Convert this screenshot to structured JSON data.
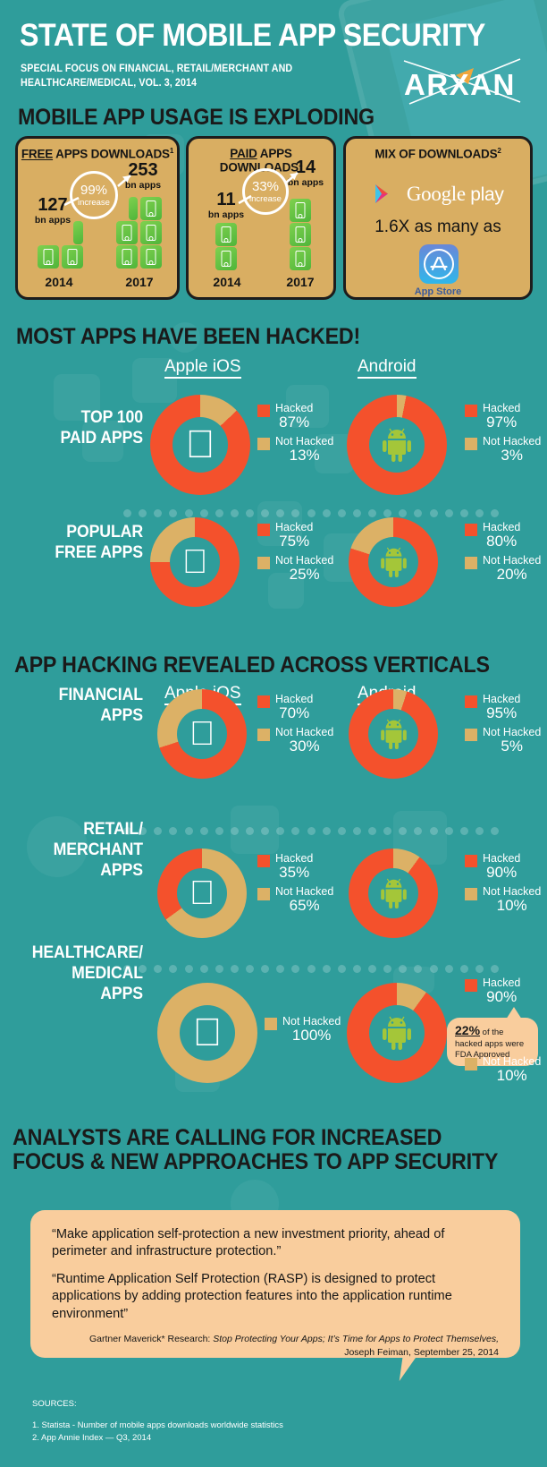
{
  "header": {
    "title": "STATE OF MOBILE APP SECURITY",
    "subtitle": "SPECIAL FOCUS ON FINANCIAL, RETAIL/MERCHANT AND\nHEALTHCARE/MEDICAL, VOL. 3, 2014",
    "logo_text": "ARXAN"
  },
  "section1": {
    "heading": "MOBILE APP USAGE IS EXPLODING",
    "boxes": [
      {
        "title_underline": "FREE",
        "title_rest": " APPS DOWNLOADS",
        "sup": "1",
        "from_value": "127",
        "from_unit": "bn apps",
        "to_value": "253",
        "to_unit": "bn apps",
        "badge_pct": "99%",
        "badge_word": "increase",
        "year_from": "2014",
        "year_to": "2017"
      },
      {
        "title_underline": "PAID",
        "title_rest": " APPS DOWNLOADS",
        "sup": "1",
        "from_value": "11",
        "from_unit": "bn apps",
        "to_value": "14",
        "to_unit": "bn apps",
        "badge_pct": "33%",
        "badge_word": "increase",
        "year_from": "2014",
        "year_to": "2017"
      }
    ],
    "mix_box": {
      "title": "MIX OF DOWNLOADS",
      "sup": "2",
      "store_a_brand": "Google",
      "store_a_brand2": "play",
      "middle_text": "1.6X as many as",
      "store_b_label": "App Store"
    }
  },
  "section2": {
    "heading": "MOST APPS HAVE BEEN HACKED!",
    "platform_labels": [
      "Apple iOS",
      "Android"
    ],
    "rows": [
      {
        "label": "TOP 100\nPAID APPS",
        "ios": {
          "hacked_label": "Hacked",
          "hacked": "87%",
          "not_label": "Not Hacked",
          "not": "13%"
        },
        "android": {
          "hacked_label": "Hacked",
          "hacked": "97%",
          "not_label": "Not Hacked",
          "not": "3%"
        }
      },
      {
        "label": "POPULAR\nFREE APPS",
        "ios": {
          "hacked_label": "Hacked",
          "hacked": "75%",
          "not_label": "Not Hacked",
          "not": "25%"
        },
        "android": {
          "hacked_label": "Hacked",
          "hacked": "80%",
          "not_label": "Not Hacked",
          "not": "20%"
        }
      }
    ]
  },
  "section3": {
    "heading": "APP HACKING REVEALED ACROSS VERTICALS",
    "platform_labels": [
      "Apple iOS",
      "Android"
    ],
    "rows": [
      {
        "label": "FINANCIAL\nAPPS",
        "ios": {
          "hacked_label": "Hacked",
          "hacked": "70%",
          "not_label": "Not Hacked",
          "not": "30%"
        },
        "android": {
          "hacked_label": "Hacked",
          "hacked": "95%",
          "not_label": "Not Hacked",
          "not": "5%"
        }
      },
      {
        "label": "RETAIL/\nMERCHANT\nAPPS",
        "ios": {
          "hacked_label": "Hacked",
          "hacked": "35%",
          "not_label": "Not Hacked",
          "not": "65%"
        },
        "android": {
          "hacked_label": "Hacked",
          "hacked": "90%",
          "not_label": "Not Hacked",
          "not": "10%"
        }
      },
      {
        "label": "HEALTHCARE/\nMEDICAL\nAPPS",
        "ios": {
          "not_label": "Not Hacked",
          "not": "100%"
        },
        "android": {
          "hacked_label": "Hacked",
          "hacked": "90%",
          "not_label": "Not Hacked",
          "not": "10%"
        },
        "callout": {
          "big": "22%",
          "small": " of the",
          "line2": "hacked apps were",
          "line3": "FDA Approved"
        }
      }
    ]
  },
  "section4": {
    "heading": "ANALYSTS ARE CALLING FOR INCREASED\nFOCUS & NEW APPROACHES TO APP SECURITY",
    "quote1": "“Make application self-protection a new investment priority, ahead of perimeter and infrastructure protection.”",
    "quote2": "“Runtime Application Self Protection (RASP) is designed to protect applications by adding protection features into the application runtime environment”",
    "cite_pre": "Gartner Maverick* Research: ",
    "cite_em": "Stop Protecting Your Apps; It’s Time for Apps to Protect Themselves,",
    "cite_post": "Joseph Feiman, September 25, 2014"
  },
  "sources": {
    "heading": "SOURCES:",
    "items": [
      "1. Statista - Number of mobile apps downloads worldwide statistics",
      "2. App Annie Index — Q3, 2014"
    ]
  },
  "colors": {
    "background": "#2f9d9b",
    "hacked": "#f4512c",
    "not_hacked": "#dcb166",
    "gold_box": "#d9ae62",
    "peach": "#f9cd9d",
    "heading_dark": "#1a1a1a",
    "white": "#ffffff"
  },
  "chart_data": [
    {
      "type": "pie",
      "title": "TOP 100 PAID APPS — Apple iOS",
      "labels": [
        "Hacked",
        "Not Hacked"
      ],
      "values": [
        87,
        13
      ],
      "unit": "%"
    },
    {
      "type": "pie",
      "title": "TOP 100 PAID APPS — Android",
      "labels": [
        "Hacked",
        "Not Hacked"
      ],
      "values": [
        97,
        3
      ],
      "unit": "%"
    },
    {
      "type": "pie",
      "title": "POPULAR FREE APPS — Apple iOS",
      "labels": [
        "Hacked",
        "Not Hacked"
      ],
      "values": [
        75,
        25
      ],
      "unit": "%"
    },
    {
      "type": "pie",
      "title": "POPULAR FREE APPS — Android",
      "labels": [
        "Hacked",
        "Not Hacked"
      ],
      "values": [
        80,
        20
      ],
      "unit": "%"
    },
    {
      "type": "pie",
      "title": "FINANCIAL APPS — Apple iOS",
      "labels": [
        "Hacked",
        "Not Hacked"
      ],
      "values": [
        70,
        30
      ],
      "unit": "%"
    },
    {
      "type": "pie",
      "title": "FINANCIAL APPS — Android",
      "labels": [
        "Hacked",
        "Not Hacked"
      ],
      "values": [
        95,
        5
      ],
      "unit": "%"
    },
    {
      "type": "pie",
      "title": "RETAIL/MERCHANT APPS — Apple iOS",
      "labels": [
        "Hacked",
        "Not Hacked"
      ],
      "values": [
        35,
        65
      ],
      "unit": "%"
    },
    {
      "type": "pie",
      "title": "RETAIL/MERCHANT APPS — Android",
      "labels": [
        "Hacked",
        "Not Hacked"
      ],
      "values": [
        90,
        10
      ],
      "unit": "%"
    },
    {
      "type": "pie",
      "title": "HEALTHCARE/MEDICAL APPS — Apple iOS",
      "labels": [
        "Hacked",
        "Not Hacked"
      ],
      "values": [
        0,
        100
      ],
      "unit": "%"
    },
    {
      "type": "pie",
      "title": "HEALTHCARE/MEDICAL APPS — Android",
      "labels": [
        "Hacked",
        "Not Hacked"
      ],
      "values": [
        90,
        10
      ],
      "unit": "%",
      "annotation": "22% of the hacked apps were FDA Approved"
    },
    {
      "type": "bar",
      "title": "FREE APPS DOWNLOADS",
      "categories": [
        "2014",
        "2017"
      ],
      "values": [
        127,
        253
      ],
      "ylabel": "bn apps",
      "annotation": "99% increase"
    },
    {
      "type": "bar",
      "title": "PAID APPS DOWNLOADS",
      "categories": [
        "2014",
        "2017"
      ],
      "values": [
        11,
        14
      ],
      "ylabel": "bn apps",
      "annotation": "33% increase"
    },
    {
      "type": "table",
      "title": "MIX OF DOWNLOADS",
      "categories": [
        "Google play",
        "App Store"
      ],
      "values": [
        1.6,
        1.0
      ],
      "annotation": "1.6X as many as"
    }
  ]
}
